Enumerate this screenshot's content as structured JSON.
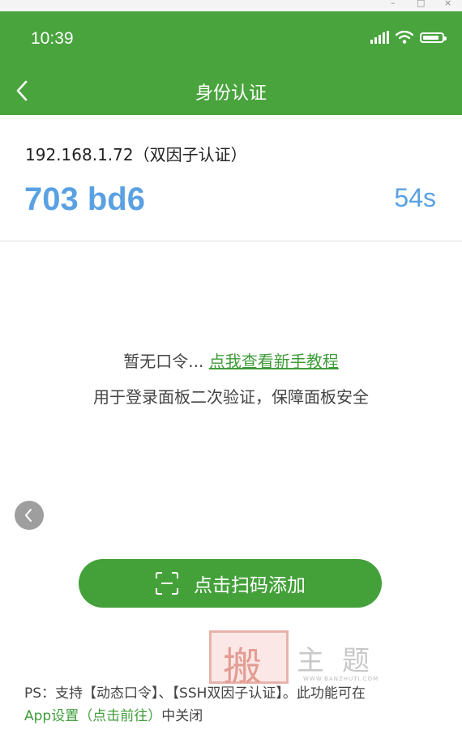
{
  "window": {
    "minimize_glyph": "–",
    "maximize_glyph": "□",
    "close_glyph": "×"
  },
  "status_bar": {
    "time": "10:39",
    "battery_level": 0.85,
    "icons": [
      "signal-icon",
      "wifi-icon",
      "battery-icon"
    ]
  },
  "nav": {
    "title": "身份认证",
    "back_icon": "chevron-left-icon"
  },
  "token": {
    "host": "192.168.1.72（双因子认证）",
    "code": "703 bd6",
    "timer": "54s"
  },
  "empty_state": {
    "message": "暂无口令... ",
    "link_text": "点我查看新手教程",
    "description": "用于登录面板二次验证，保障面板安全"
  },
  "scan_button": {
    "label": "点击扫码添加",
    "icon": "scan-icon"
  },
  "watermark": {
    "char": "搬",
    "text": "主题",
    "url": "WWW.BANZHUTI.COM"
  },
  "ps_note": {
    "line1": "PS：支持【动态口令】、【SSH双因子认证】。此功能可在",
    "link": "App设置（点击前往）",
    "line2_rest": "中关闭"
  },
  "colors": {
    "brand_green": "#4aa43e",
    "button_green": "#44a13a",
    "token_blue": "#5aa1e3",
    "link_green": "#3f9c3a"
  }
}
